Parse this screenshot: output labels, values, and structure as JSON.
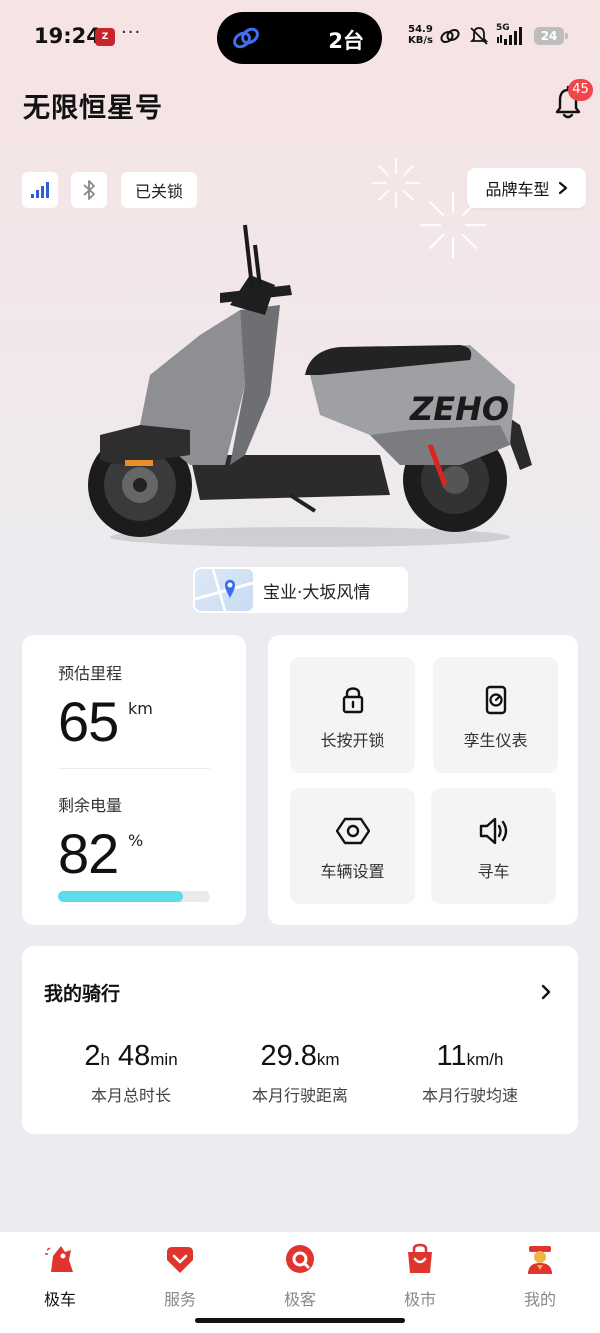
{
  "status_bar": {
    "time": "19:24",
    "app_icon_text": "Z",
    "dots": "···",
    "island_count": "2台",
    "net_speed_value": "54.9",
    "net_speed_unit": "KB/s",
    "network": "5G",
    "battery": "24",
    "icons": [
      "link-icon",
      "mute-bell-icon",
      "signal-icon"
    ]
  },
  "header": {
    "title": "无限恒星号",
    "notification_count": "45"
  },
  "chips": {
    "lock_status": "已关锁",
    "brand_button": "品牌车型"
  },
  "location": {
    "text": "宝业·大坂风情"
  },
  "stats": {
    "range_label": "预估里程",
    "range_value": "65",
    "range_unit": "km",
    "battery_label": "剩余电量",
    "battery_value": "82",
    "battery_unit": "%",
    "battery_fraction": 0.82
  },
  "actions": [
    {
      "label": "长按开锁",
      "icon": "lock-icon"
    },
    {
      "label": "孪生仪表",
      "icon": "dashboard-icon"
    },
    {
      "label": "车辆设置",
      "icon": "settings-hex-icon"
    },
    {
      "label": "寻车",
      "icon": "speaker-icon"
    }
  ],
  "ride": {
    "title": "我的骑行",
    "items": [
      {
        "value_h": "2",
        "unit_h": "h",
        "value_m": "48",
        "unit_m": "min",
        "label": "本月总时长"
      },
      {
        "value": "29.8",
        "unit": "km",
        "label": "本月行驶距离"
      },
      {
        "value": "11",
        "unit": "km/h",
        "label": "本月行驶均速"
      }
    ]
  },
  "nav": {
    "items": [
      {
        "label": "极车",
        "icon": "scooter-icon",
        "active": true
      },
      {
        "label": "服务",
        "icon": "service-icon",
        "active": false
      },
      {
        "label": "极客",
        "icon": "geek-icon",
        "active": false
      },
      {
        "label": "极市",
        "icon": "shop-bag-icon",
        "active": false
      },
      {
        "label": "我的",
        "icon": "profile-icon",
        "active": false
      }
    ]
  },
  "colors": {
    "accent_red": "#e0352f",
    "progress_fill": "#5cdbe8",
    "badge": "#f0454b"
  }
}
